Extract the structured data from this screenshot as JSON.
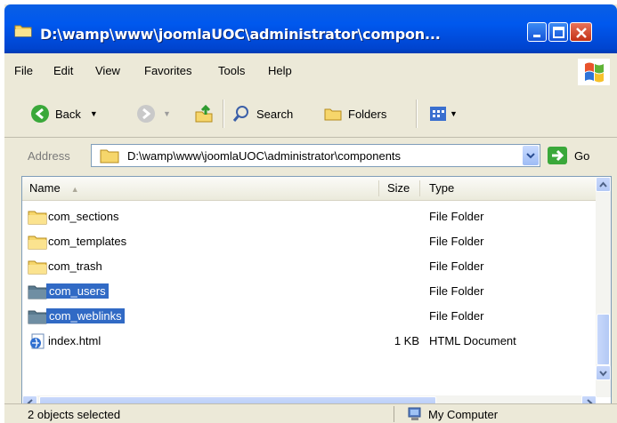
{
  "window": {
    "title": "D:\\wamp\\www\\joomlaUOC\\administrator\\compon..."
  },
  "menu": [
    "File",
    "Edit",
    "View",
    "Favorites",
    "Tools",
    "Help"
  ],
  "toolbar": {
    "back_label": "Back",
    "search_label": "Search",
    "folders_label": "Folders"
  },
  "address": {
    "label": "Address",
    "value": "D:\\wamp\\www\\joomlaUOC\\administrator\\components",
    "go_label": "Go"
  },
  "columns": {
    "name": "Name",
    "size": "Size",
    "type": "Type"
  },
  "files": [
    {
      "name": "com_sections",
      "size": "",
      "type": "File Folder",
      "icon": "folder-icon",
      "selected": false
    },
    {
      "name": "com_templates",
      "size": "",
      "type": "File Folder",
      "icon": "folder-icon",
      "selected": false
    },
    {
      "name": "com_trash",
      "size": "",
      "type": "File Folder",
      "icon": "folder-icon",
      "selected": false
    },
    {
      "name": "com_users",
      "size": "",
      "type": "File Folder",
      "icon": "folder-icon",
      "selected": true
    },
    {
      "name": "com_weblinks",
      "size": "",
      "type": "File Folder",
      "icon": "folder-icon",
      "selected": true
    },
    {
      "name": "index.html",
      "size": "1 KB",
      "type": "HTML Document",
      "icon": "html-document-icon",
      "selected": false
    }
  ],
  "status": {
    "left": "2 objects selected",
    "right": "My Computer"
  },
  "colors": {
    "titlebar": "#0058EE",
    "selection": "#316AC5",
    "chrome": "#ECE9D8"
  }
}
